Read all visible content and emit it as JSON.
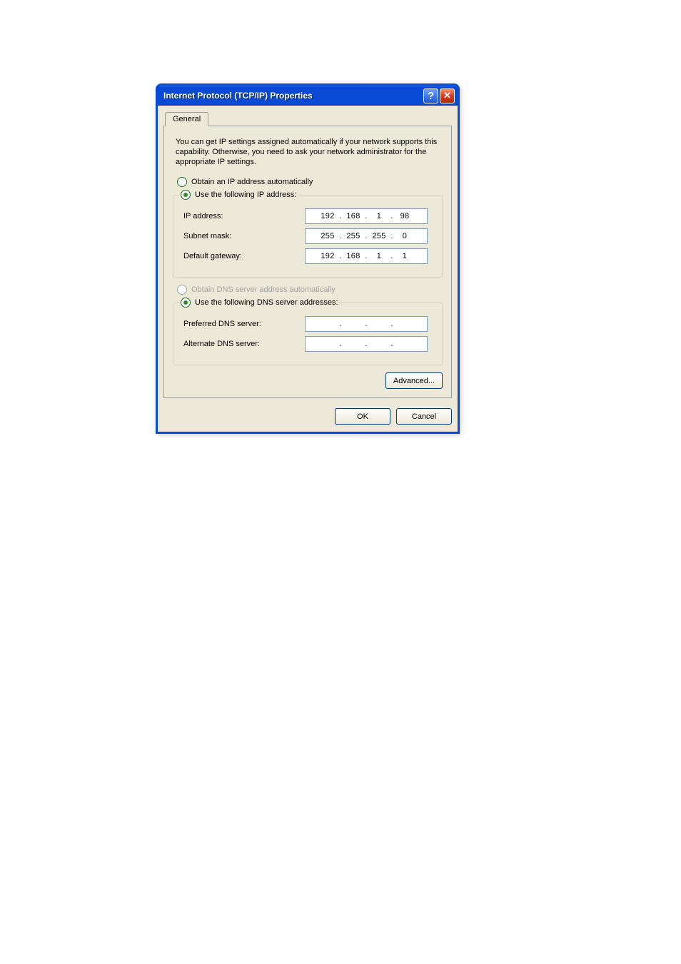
{
  "window": {
    "title": "Internet Protocol (TCP/IP) Properties"
  },
  "tabs": {
    "general": "General"
  },
  "infoText": "You can get IP settings assigned automatically if your network supports this capability. Otherwise, you need to ask your network administrator for the appropriate IP settings.",
  "ip": {
    "radioAuto": "Obtain an IP address automatically",
    "radioManual": "Use the following IP address:",
    "labels": {
      "ip": "IP address:",
      "subnet": "Subnet mask:",
      "gateway": "Default gateway:"
    },
    "values": {
      "ip": {
        "o1": "192",
        "o2": "168",
        "o3": "1",
        "o4": "98"
      },
      "subnet": {
        "o1": "255",
        "o2": "255",
        "o3": "255",
        "o4": "0"
      },
      "gateway": {
        "o1": "192",
        "o2": "168",
        "o3": "1",
        "o4": "1"
      }
    }
  },
  "dns": {
    "radioAuto": "Obtain DNS server address automatically",
    "radioManual": "Use the following DNS server addresses:",
    "labels": {
      "preferred": "Preferred DNS server:",
      "alternate": "Alternate DNS server:"
    },
    "values": {
      "preferred": {
        "o1": "",
        "o2": "",
        "o3": "",
        "o4": ""
      },
      "alternate": {
        "o1": "",
        "o2": "",
        "o3": "",
        "o4": ""
      }
    }
  },
  "buttons": {
    "advanced": "Advanced...",
    "ok": "OK",
    "cancel": "Cancel"
  },
  "dot": "."
}
